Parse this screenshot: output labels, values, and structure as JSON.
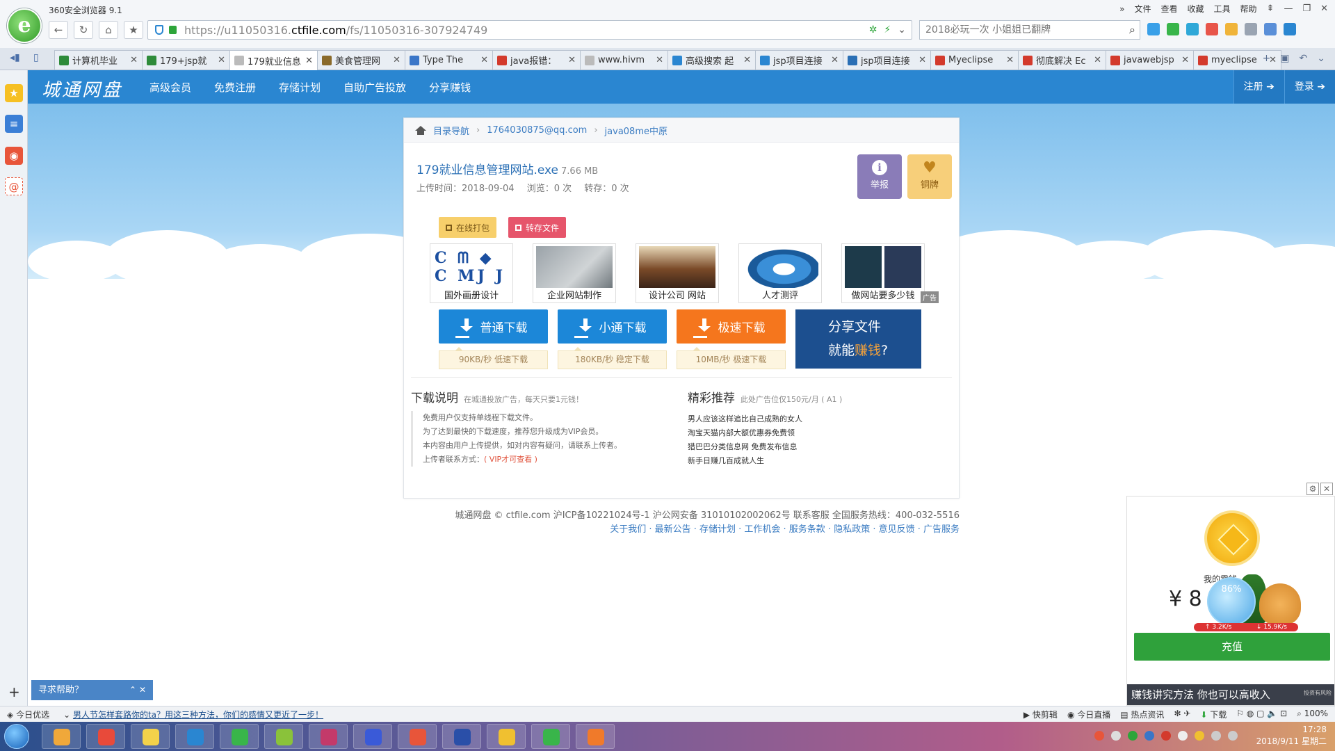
{
  "browser": {
    "title": "360安全浏览器 9.1",
    "menu": [
      "文件",
      "查看",
      "收藏",
      "工具",
      "帮助"
    ],
    "url_prefix": "https://u11050316.",
    "url_domain": "ctfile.com",
    "url_path": "/fs/11050316-307924749",
    "search_placeholder": "2018必玩一次 小姐姐已翻牌",
    "tabs": [
      {
        "label": "计算机毕业",
        "color": "#2e8b3a"
      },
      {
        "label": "179+jsp就",
        "color": "#2e8b3a"
      },
      {
        "label": "179就业信息",
        "color": "#bbbbbb",
        "active": true
      },
      {
        "label": "美食管理网",
        "color": "#8a6a2a"
      },
      {
        "label": "Type The",
        "color": "#3a76c8"
      },
      {
        "label": "java报错：",
        "color": "#d33a2c"
      },
      {
        "label": "www.hivm",
        "color": "#bbbbbb"
      },
      {
        "label": "高级搜索 起",
        "color": "#2a86d1"
      },
      {
        "label": "jsp项目连接",
        "color": "#2a86d1"
      },
      {
        "label": "jsp项目连接",
        "color": "#2a6fb5"
      },
      {
        "label": "Myeclipse",
        "color": "#d33a2c"
      },
      {
        "label": "彻底解决 Ec",
        "color": "#d33a2c"
      },
      {
        "label": "javawebjsp",
        "color": "#d33a2c"
      },
      {
        "label": "myeclipse",
        "color": "#d33a2c"
      }
    ]
  },
  "site": {
    "logo": "城通网盘",
    "nav": [
      "高级会员",
      "免费注册",
      "存储计划",
      "自助广告投放",
      "分享赚钱"
    ],
    "register": "注册",
    "login": "登录"
  },
  "breadcrumb": [
    "目录导航",
    "1764030875@qq.com",
    "java08me中原"
  ],
  "file": {
    "name": "179就业信息管理网站.exe",
    "size": "7.66 MB",
    "upload_time": "上传时间：2018-09-04",
    "views": "浏览：0 次",
    "saves": "转存：0 次"
  },
  "actions": {
    "report": "举报",
    "medal": "铜牌",
    "pack": "在线打包",
    "save": "转存文件"
  },
  "ads": [
    {
      "label": "国外画册设计"
    },
    {
      "label": "企业网站制作"
    },
    {
      "label": "设计公司 网站"
    },
    {
      "label": "人才测评"
    },
    {
      "label": "做网站要多少钱"
    }
  ],
  "ad_tag": "广告",
  "downloads": [
    {
      "label": "普通下载",
      "speed": "90KB/秒 低速下载"
    },
    {
      "label": "小通下载",
      "speed": "180KB/秒 稳定下载"
    },
    {
      "label": "极速下载",
      "speed": "10MB/秒 极速下载"
    }
  ],
  "share_banner": {
    "line1": "分享文件",
    "line2_a": "就能",
    "line2_b": "赚钱",
    "line2_c": "?"
  },
  "download_notes": {
    "title": "下载说明",
    "subtitle": "在城通投放广告，每天只要1元钱！",
    "lines": [
      "免费用户仅支持单线程下载文件。",
      "为了达到最快的下载速度，推荐您升级成为VIP会员。",
      "本内容由用户上传提供，如对内容有疑问，请联系上传者。"
    ],
    "contact_prefix": "上传者联系方式：",
    "contact_link": "( VIP才可查看 )"
  },
  "recommend": {
    "title": "精彩推荐",
    "subtitle": "此处广告位仅150元/月 ( A1 )",
    "items": [
      "男人应该这样追比自己成熟的女人",
      "淘宝天猫内部大额优惠券免费领",
      "猎巴巴分类信息网 免费发布信息",
      "新手日赚几百成就人生"
    ]
  },
  "footer": {
    "line1": "城通网盘 © ctfile.com 沪ICP备10221024号-1 沪公网安备 31010102002062号 联系客服 全国服务热线：400-032-5516",
    "line2": "关于我们 · 最新公告 · 存储计划 · 工作机会 · 服务条款 · 隐私政策 · 意见反馈 · 广告服务"
  },
  "help_widget": "寻求帮助？",
  "side_ad": {
    "wallet": "我的零钱",
    "money": "¥ 8",
    "percent": "86%",
    "up": "3.2K/s",
    "down": "15.9K/s",
    "button": "充值",
    "banner": "赚钱讲究方法 你也可以高收入",
    "tag": "投资有风险"
  },
  "statusbar": {
    "left1": "今日优选",
    "news": "男人节怎样套路你的ta？用这三种方法，你们的感情又更近了一步！",
    "right": [
      "快剪辑",
      "今日直播",
      "热点资讯",
      "下载",
      "100%"
    ]
  },
  "clock": {
    "time": "17:28",
    "date": "2018/9/11 星期二"
  }
}
